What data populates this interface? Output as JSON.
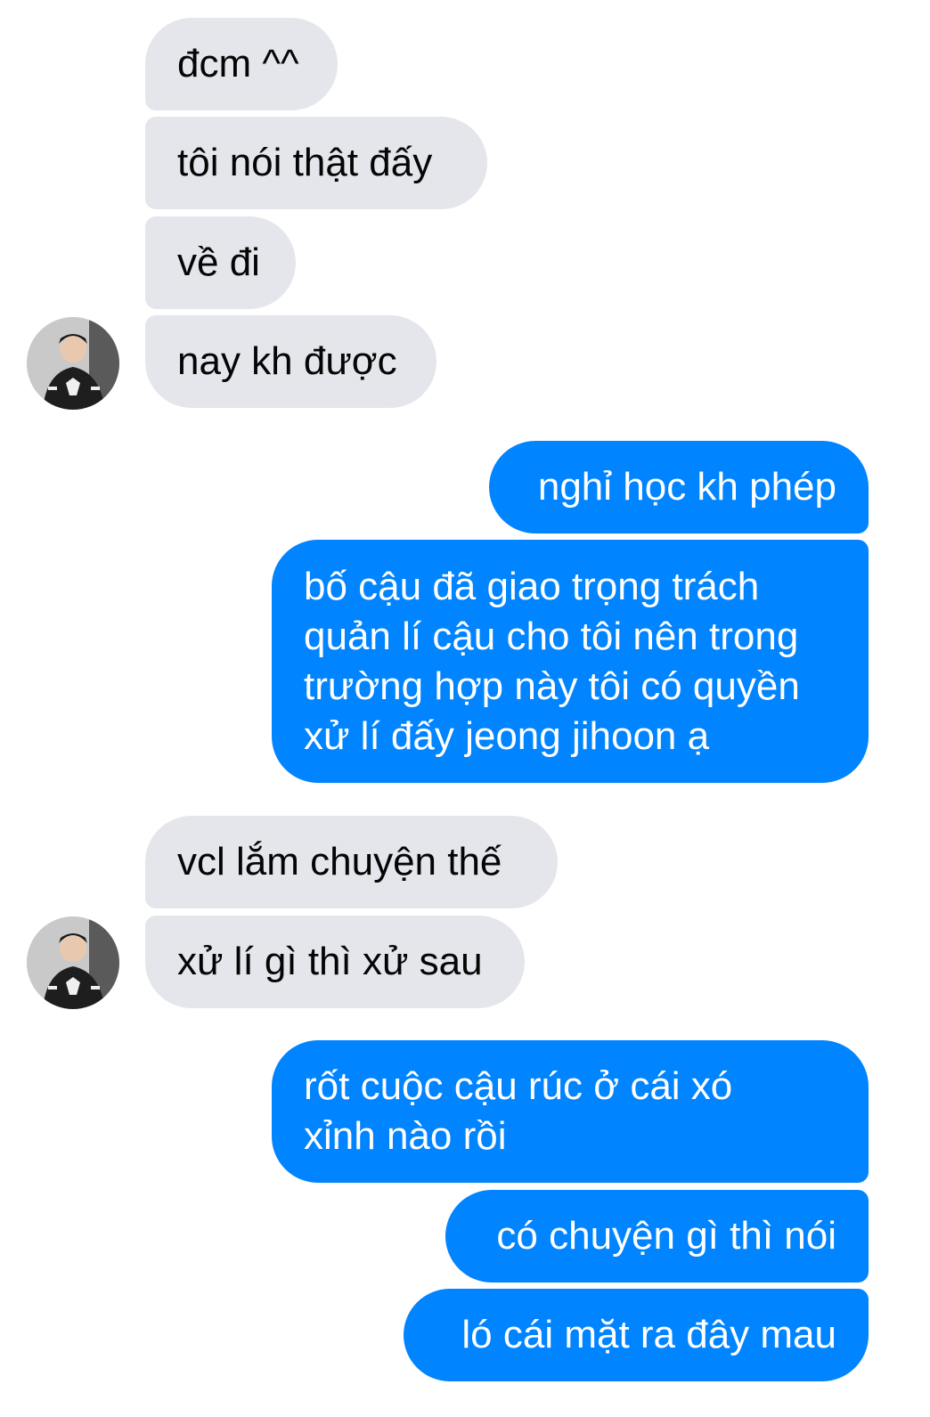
{
  "messages": [
    {
      "from": "them",
      "text": "đcm ^^"
    },
    {
      "from": "them",
      "text": "tôi nói thật đấy"
    },
    {
      "from": "them",
      "text": "về đi"
    },
    {
      "from": "them",
      "text": "nay kh được"
    },
    {
      "from": "me",
      "text": "nghỉ học kh phép"
    },
    {
      "from": "me",
      "lines": [
        "bố cậu đã giao trọng trách",
        "quản lí cậu cho tôi nên trong",
        "trường hợp này tôi có quyền",
        "xử lí đấy jeong jihoon ạ"
      ]
    },
    {
      "from": "them",
      "text": "vcl lắm chuyện thế"
    },
    {
      "from": "them",
      "text": "xử lí gì thì xử sau"
    },
    {
      "from": "me",
      "lines": [
        "rốt cuộc cậu rúc ở cái xó",
        "xỉnh nào rồi"
      ]
    },
    {
      "from": "me",
      "text": "có chuyện gì thì nói"
    },
    {
      "from": "me",
      "text": "ló cái mặt ra đây mau"
    }
  ],
  "colors": {
    "incoming_bg": "#e4e6eb",
    "outgoing_bg": "#0084ff",
    "outgoing_text": "#ffffff"
  },
  "icons": {
    "avatar": "contact-avatar-photo"
  }
}
